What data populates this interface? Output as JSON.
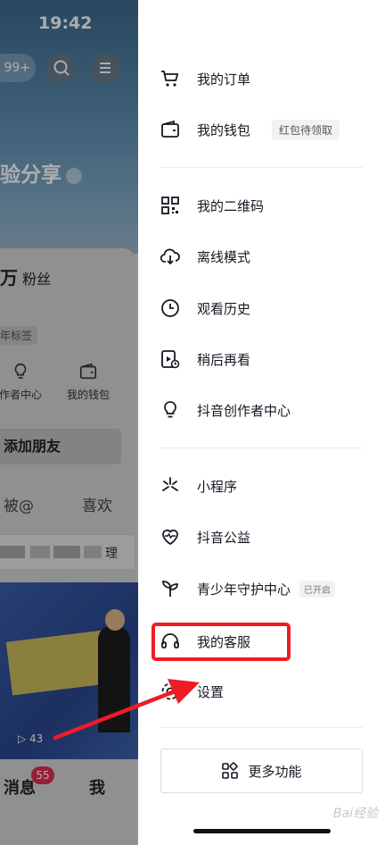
{
  "status_bar": {
    "time": "19:42"
  },
  "background_app": {
    "counter_pill": "99+",
    "nickname": "验分享",
    "fans_count": "万",
    "fans_label": "粉丝",
    "tag": "年标签",
    "tools": [
      {
        "label": "作者中心",
        "icon": "bulb-icon"
      },
      {
        "label": "我的钱包",
        "icon": "wallet-icon"
      }
    ],
    "add_friend": "添加朋友",
    "profile_tabs": [
      "被@",
      "喜欢"
    ],
    "bar_text": "理",
    "video_plays": "43",
    "bottom_nav": {
      "messages": "消息",
      "messages_badge": "55",
      "me": "我"
    }
  },
  "drawer": {
    "groups": [
      [
        {
          "label": "我的订单",
          "icon": "cart-icon"
        },
        {
          "label": "我的钱包",
          "icon": "wallet-icon",
          "chip": "红包待领取"
        }
      ],
      [
        {
          "label": "我的二维码",
          "icon": "qrcode-icon"
        },
        {
          "label": "离线模式",
          "icon": "cloud-download-icon"
        },
        {
          "label": "观看历史",
          "icon": "clock-icon"
        },
        {
          "label": "稍后再看",
          "icon": "watch-later-icon"
        },
        {
          "label": "抖音创作者中心",
          "icon": "bulb-icon"
        }
      ],
      [
        {
          "label": "小程序",
          "icon": "asterisk-icon"
        },
        {
          "label": "抖音公益",
          "icon": "heart-icon"
        },
        {
          "label": "青少年守护中心",
          "icon": "sprout-icon",
          "chip": "已开启"
        },
        {
          "label": "我的客服",
          "icon": "headset-icon"
        },
        {
          "label": "设置",
          "icon": "gear-icon"
        }
      ]
    ],
    "more_button": "更多功能"
  },
  "watermark": "Bai经验",
  "annotation": {
    "highlight_color": "#ee1c25",
    "highlighted_item": "我的客服"
  }
}
